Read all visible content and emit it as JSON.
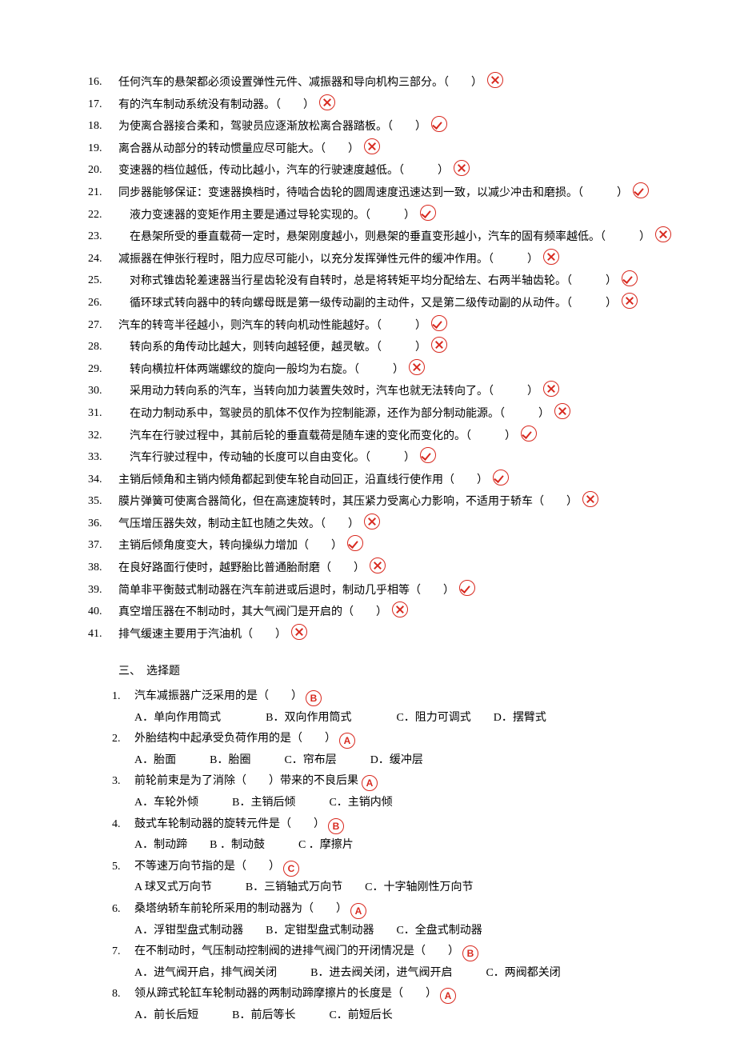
{
  "tf_questions": [
    {
      "num": "16.",
      "text": "任何汽车的悬架都必须设置弹性元件、减振器和导向机构三部分。（　　）",
      "mark": "cross"
    },
    {
      "num": "17.",
      "text": "有的汽车制动系统没有制动器。（　　）",
      "mark": "cross"
    },
    {
      "num": "18.",
      "text": "为使离合器接合柔和，驾驶员应逐渐放松离合器踏板。（　　）",
      "mark": "check"
    },
    {
      "num": "19.",
      "text": "离合器从动部分的转动惯量应尽可能大。（　　）",
      "mark": "cross"
    },
    {
      "num": "20.",
      "text": "变速器的档位越低，传动比越小，汽车的行驶速度越低。（　　　）",
      "mark": "cross"
    },
    {
      "num": "21.",
      "text": "同步器能够保证：变速器换档时，待啮合齿轮的圆周速度迅速达到一致，以减少冲击和磨损。（　　　）",
      "mark": "check"
    },
    {
      "num": "22.",
      "text": "　液力变速器的变矩作用主要是通过导轮实现的。（　　　）",
      "mark": "check"
    },
    {
      "num": "23.",
      "text": "　在悬架所受的垂直载荷一定时，悬架刚度越小，则悬架的垂直变形越小，汽车的固有频率越低。（　　　）",
      "mark": "cross"
    },
    {
      "num": "24.",
      "text": "减振器在伸张行程时，阻力应尽可能小，以充分发挥弹性元件的缓冲作用。（　　　）",
      "mark": "cross"
    },
    {
      "num": "25.",
      "text": "　对称式锥齿轮差速器当行星齿轮没有自转时，总是将转矩平均分配给左、右两半轴齿轮。（　　　）",
      "mark": "check"
    },
    {
      "num": "26.",
      "text": "　循环球式转向器中的转向螺母既是第一级传动副的主动件，又是第二级传动副的从动件。（　　　）",
      "mark": "cross"
    },
    {
      "num": "27.",
      "text": "汽车的转弯半径越小，则汽车的转向机动性能越好。（　　　）",
      "mark": "check"
    },
    {
      "num": "28.",
      "text": "　转向系的角传动比越大，则转向越轻便，越灵敏。（　　　）",
      "mark": "cross"
    },
    {
      "num": "29.",
      "text": "　转向横拉杆体两端螺纹的旋向一般均为右旋。（　　　）",
      "mark": "cross"
    },
    {
      "num": "30.",
      "text": "　采用动力转向系的汽车，当转向加力装置失效时，汽车也就无法转向了。（　　　）",
      "mark": "cross"
    },
    {
      "num": "31.",
      "text": "　在动力制动系中，驾驶员的肌体不仅作为控制能源，还作为部分制动能源。（　　　）",
      "mark": "cross"
    },
    {
      "num": "32.",
      "text": "　汽车在行驶过程中，其前后轮的垂直载荷是随车速的变化而变化的。（　　　）",
      "mark": "check"
    },
    {
      "num": "33.",
      "text": "　汽车行驶过程中，传动轴的长度可以自由变化。（　　　）",
      "mark": "check"
    },
    {
      "num": "34.",
      "text": "主销后倾角和主销内倾角都起到使车轮自动回正，沿直线行使作用（　　）",
      "mark": "check"
    },
    {
      "num": "35.",
      "text": "膜片弹簧可使离合器简化，但在高速旋转时，其压紧力受离心力影响，不适用于轿车（　　）",
      "mark": "cross"
    },
    {
      "num": "36.",
      "text": "气压增压器失效，制动主缸也随之失效。（　　）",
      "mark": "cross"
    },
    {
      "num": "37.",
      "text": "主销后倾角度变大，转向操纵力增加（　　）",
      "mark": "check"
    },
    {
      "num": "38.",
      "text": "在良好路面行使时，越野胎比普通胎耐磨（　　）",
      "mark": "cross"
    },
    {
      "num": "39.",
      "text": "简单非平衡鼓式制动器在汽车前进或后退时，制动几乎相等（　　）",
      "mark": "check"
    },
    {
      "num": "40.",
      "text": "真空增压器在不制动时，其大气阀门是开启的（　　）",
      "mark": "cross"
    },
    {
      "num": "41.",
      "text": "排气缓速主要用于汽油机（　　）",
      "mark": "cross"
    }
  ],
  "mc_title": "三、　选择题",
  "mc_questions": [
    {
      "num": "1.",
      "stem": "汽车减振器广泛采用的是（　　）",
      "ans": "B",
      "opts": "A．单向作用筒式　　　　B．双向作用筒式　　　　C．阻力可调式　　D．摆臂式"
    },
    {
      "num": "2.",
      "stem": "外胎结构中起承受负荷作用的是（　　）",
      "ans": "A",
      "opts": "A．胎面　　　B．胎圈　　　C．帘布层　　　D．缓冲层"
    },
    {
      "num": "3.",
      "stem": "前轮前束是为了消除（　　）带来的不良后果",
      "ans": "A",
      "opts": "A．车轮外倾　　　B．主销后倾　　　C．主销内倾"
    },
    {
      "num": "4.",
      "stem": "鼓式车轮制动器的旋转元件是（　　）",
      "ans": "B",
      "opts": "A．制动蹄　　B ．制动鼓　　　C ．摩擦片"
    },
    {
      "num": "5.",
      "stem": "不等速万向节指的是（　　）",
      "ans": "C",
      "opts": "A 球叉式万向节　　　B．三销轴式万向节　　C．十字轴刚性万向节"
    },
    {
      "num": "6.",
      "stem": "桑塔纳轿车前轮所采用的制动器为（　　）",
      "ans": "A",
      "opts": "A．浮钳型盘式制动器　　B．定钳型盘式制动器　　C．全盘式制动器"
    },
    {
      "num": "7.",
      "stem": "在不制动时，气压制动控制阀的进排气阀门的开闭情况是（　　）",
      "ans": "B",
      "opts": "A．进气阀开启，排气阀关闭　　　B．进去阀关闭，进气阀开启　　　C．两阀都关闭"
    },
    {
      "num": "8.",
      "stem": "领从蹄式轮缸车轮制动器的两制动蹄摩擦片的长度是（　　）",
      "ans": "A",
      "opts": "A．前长后短　　　B．前后等长　　　C．前短后长"
    }
  ]
}
